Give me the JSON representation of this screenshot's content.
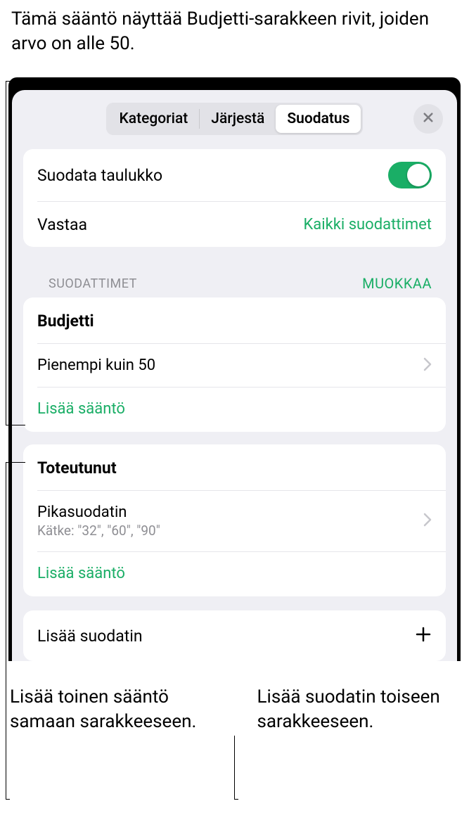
{
  "callouts": {
    "top": "Tämä sääntö näyttää Budjetti-sarakkeen rivit, joiden arvo on alle 50.",
    "bottomLeft": "Lisää toinen sääntö samaan sarakkeeseen.",
    "bottomRight": "Lisää suodatin toiseen sarakkeeseen."
  },
  "tabs": {
    "categories": "Kategoriat",
    "sort": "Järjestä",
    "filter": "Suodatus"
  },
  "filterTable": {
    "label": "Suodata taulukko",
    "matchLabel": "Vastaa",
    "matchValue": "Kaikki suodattimet"
  },
  "section": {
    "title": "SUODATTIMET",
    "edit": "MUOKKAA"
  },
  "filters": [
    {
      "column": "Budjetti",
      "ruleText": "Pienempi kuin 50",
      "subtitle": "",
      "addRule": "Lisää sääntö"
    },
    {
      "column": "Toteutunut",
      "ruleText": "Pikasuodatin",
      "subtitle": "Kätke: ″32″, ″60″, ″90″",
      "addRule": "Lisää sääntö"
    }
  ],
  "addFilter": "Lisää suodatin"
}
